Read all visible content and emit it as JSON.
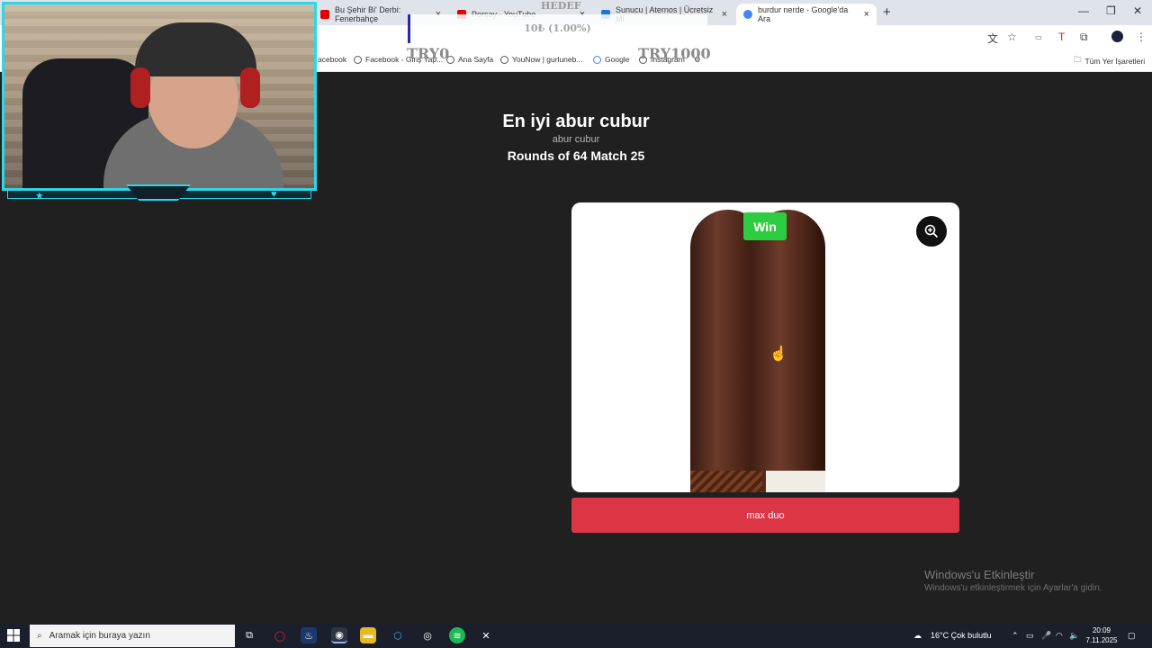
{
  "browser": {
    "tabs": [
      {
        "title": "Bu Şehir Bi' Derbi: Fenerbahçe",
        "color": "#e00000"
      },
      {
        "title": "Porsay - YouTube",
        "color": "#e00000"
      },
      {
        "title": "Sunucu | Aternos | Ücretsiz Mi",
        "color": "#1a73e8"
      },
      {
        "title": "burdur nerde - Google'da Ara",
        "color": "#4285f4"
      }
    ],
    "bookmarks": [
      "acebook",
      "Facebook - Giriş Yap...",
      "Ana Sayfa",
      "YouNow | gurluneb...",
      "Google",
      "Instagram"
    ],
    "all_bookmarks_label": "Tüm Yer İşaretleri"
  },
  "donation": {
    "title": "HEDEF",
    "amount": "10₺ (1.00%)",
    "progress_percent": 1.0,
    "min": "TRY0",
    "max": "TRY1000",
    "fill_color": "#2a2aa6"
  },
  "page": {
    "title": "En iyi abur cubur",
    "subtitle": "abur cubur",
    "round": "Rounds of 64 Match 25",
    "win_badge": "Win",
    "choice_label": "max duo",
    "choice_color": "#dc3545"
  },
  "watermark": {
    "title": "Windows'u Etkinleştir",
    "subtitle": "Windows'u etkinleştirmek için Ayarlar'a gidin."
  },
  "taskbar": {
    "search_placeholder": "Aramak için buraya yazın",
    "weather": "16°C  Çok bulutlu",
    "time": "20:09",
    "date": "7.11.2025"
  }
}
